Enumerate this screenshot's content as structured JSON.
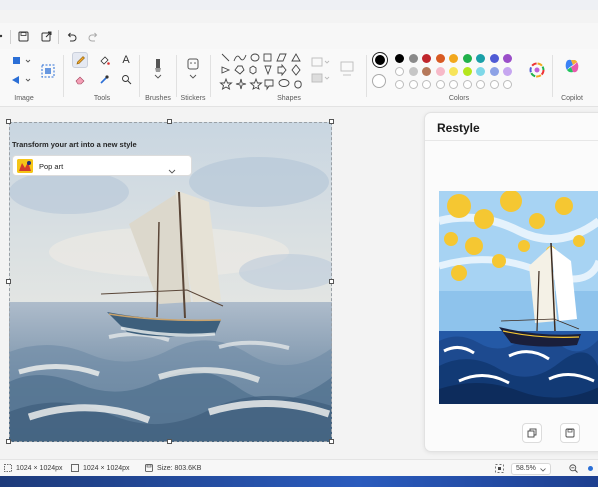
{
  "ribbon": {
    "groups": {
      "image": "Image",
      "tools": "Tools",
      "brushes": "Brushes",
      "stickers": "Stickers",
      "shapes": "Shapes",
      "colors": "Colors",
      "copilot": "Copilot"
    },
    "tools_text_glyph": "A",
    "active_color": "#000000",
    "palette_row1": [
      "#000000",
      "#8a8a8a",
      "#c0262d",
      "#d85a23",
      "#f2a81d",
      "#21b14b",
      "#1aa0a8",
      "#4f5bd5",
      "#9b4fc9"
    ],
    "palette_row2": [
      "empty",
      "#c6c6c6",
      "#b5785a",
      "#f7b9c8",
      "#f7e45a",
      "#b5e61d",
      "#7fd8e8",
      "#8da2e6",
      "#c6a6f0"
    ],
    "palette_row3": [
      "empty",
      "empty",
      "empty",
      "empty",
      "empty",
      "empty",
      "empty",
      "empty",
      "empty"
    ]
  },
  "restyle": {
    "title": "Restyle",
    "subtitle": "Transform your art into a new style",
    "selected_style": "Pop art"
  },
  "status": {
    "selection_size": "1024 × 1024px",
    "canvas_size": "1024 × 1024px",
    "file_size": "Size: 803.6KB",
    "zoom": "58.5%"
  }
}
